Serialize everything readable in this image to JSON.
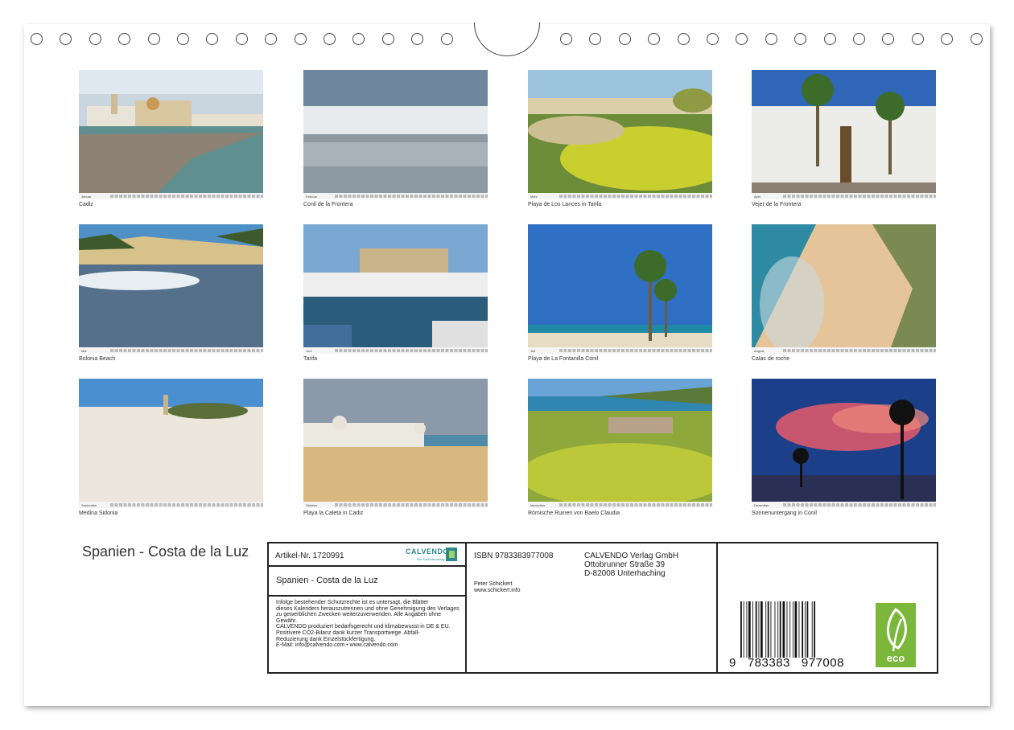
{
  "calendar": {
    "title": "Spanien - Costa de la Luz",
    "photos": [
      {
        "month": "Januar",
        "caption": "Cadiz",
        "scene": "coast-city"
      },
      {
        "month": "Februar",
        "caption": "Conil de la Frontera",
        "scene": "reflection-town"
      },
      {
        "month": "März",
        "caption": "Playa de Los Lances in Tarifa",
        "scene": "dunes-flowers"
      },
      {
        "month": "April",
        "caption": "Vejer de la Frontera",
        "scene": "plaza-palms"
      },
      {
        "month": "Mai",
        "caption": "Bolonia Beach",
        "scene": "beach-dune"
      },
      {
        "month": "Juni",
        "caption": "Tarifa",
        "scene": "harbour"
      },
      {
        "month": "Juli",
        "caption": "Playa de La Fontanilla Conil",
        "scene": "palms-beach"
      },
      {
        "month": "August",
        "caption": "Calas de roche",
        "scene": "aerial-cove"
      },
      {
        "month": "September",
        "caption": "Medina Sidonia",
        "scene": "white-town"
      },
      {
        "month": "Oktober",
        "caption": "Playa la Caleta in Cadiz",
        "scene": "caleta"
      },
      {
        "month": "November",
        "caption": "Römische Ruinen von Baelo Claudia",
        "scene": "ruins-meadow"
      },
      {
        "month": "Dezember",
        "caption": "Sonnenuntergang in Conil",
        "scene": "sunset-palms"
      }
    ]
  },
  "info": {
    "article": "Artikel-Nr. 1720991",
    "logo": "CALVENDO",
    "logo_sub": "Der Kalenderverlag",
    "product_title": "Spanien - Costa de la Luz",
    "legal": [
      "Infolge bestehender Schutzrechte ist es untersagt, die Blätter",
      "dieses Kalenders herauszutrennen und ohne Genehmigung des Verlages",
      "zu gewerblichen Zwecken weiterzuverwenden. Alle Angaben ohne",
      "Gewähr.",
      "CALVENDO produziert bedarfsgerecht und klimabewusst in DE & EU.",
      "Positivere CO2-Bilanz dank kurzer Transportwege. Abfall-",
      "Reduzierung dank Einzelstückfertigung.",
      "E-Mail: info@calvendo.com • www.calvendo.com"
    ],
    "isbn": "ISBN 9783383977008",
    "author": "Peter Schickert",
    "author_url": "www.schickert.info",
    "publisher": [
      "CALVENDO Verlag GmbH",
      "Ottobrunner Straße 39",
      "D-82008 Unterhaching"
    ],
    "barcode_digits": "9   783383   977008",
    "eco_label": "eco"
  },
  "colors": {
    "logo": "#2c8a8a",
    "eco": "#7ab73a"
  }
}
